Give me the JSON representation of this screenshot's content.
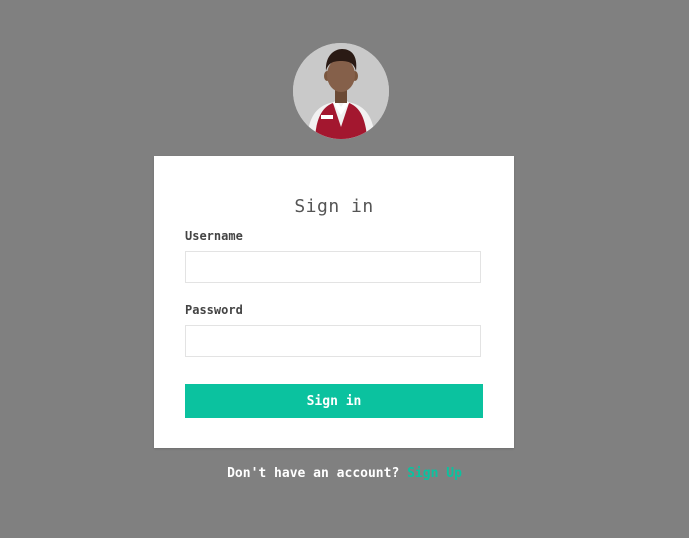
{
  "login": {
    "title": "Sign in",
    "username_label": "Username",
    "username_value": "",
    "password_label": "Password",
    "password_value": "",
    "submit_label": "Sign in"
  },
  "footer": {
    "prompt": "Don't have an account?",
    "link_label": "Sign Up"
  },
  "colors": {
    "background": "#808080",
    "card": "#ffffff",
    "accent": "#0bc29f",
    "avatar_bg": "#c9c9c9",
    "vest": "#a3172f"
  },
  "icons": {
    "avatar": "user-avatar-icon"
  }
}
